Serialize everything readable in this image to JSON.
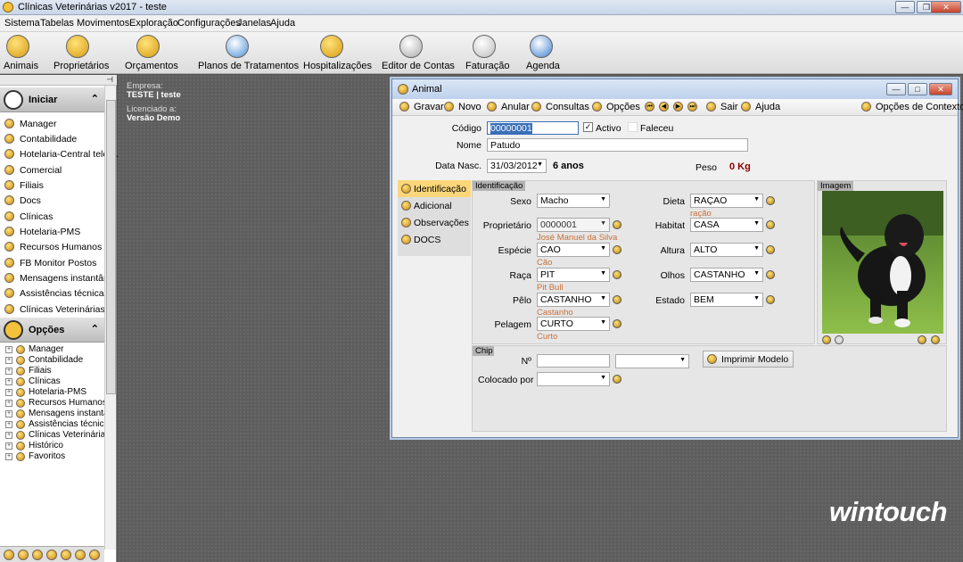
{
  "app": {
    "title": "Clínicas Veterinárias v2017 - teste"
  },
  "menu": [
    "Sistema",
    "Tabelas",
    "Movimentos",
    "Exploração",
    "Configurações",
    "Janelas",
    "Ajuda"
  ],
  "toolbar": [
    {
      "label": "Animais",
      "icon": "paw-icon"
    },
    {
      "label": "Proprietários",
      "icon": "hand-icon"
    },
    {
      "label": "Orçamentos",
      "icon": "calculator-icon"
    },
    {
      "label": "Planos de Tratamentos",
      "icon": "heart-plan-icon"
    },
    {
      "label": "Hospitalizações",
      "icon": "medical-cross-icon"
    },
    {
      "label": "Editor de Contas",
      "icon": "pen-edit-icon"
    },
    {
      "label": "Faturação",
      "icon": "coins-icon"
    },
    {
      "label": "Agenda",
      "icon": "agenda-check-icon"
    }
  ],
  "sidebar": {
    "pin": "⊣",
    "iniciar": {
      "title": "Iniciar",
      "items": [
        "Manager",
        "Contabilidade",
        "Hotelaria-Central telef...",
        "Comercial",
        "Filiais",
        "Docs",
        "Clínicas",
        "Hotelaria-PMS",
        "Recursos Humanos",
        "FB Monitor Postos",
        "Mensagens instantân...",
        "Assistências técnicas",
        "Clínicas Veterinárias"
      ]
    },
    "opcoes": {
      "title": "Opções",
      "items": [
        "Manager",
        "Contabilidade",
        "Filiais",
        "Clínicas",
        "Hotelaria-PMS",
        "Recursos Humanos",
        "Mensagens instantân",
        "Assistências técnicas",
        "Clínicas Veterinárias",
        "Histórico",
        "Favoritos"
      ]
    }
  },
  "company": {
    "empresa_label": "Empresa:",
    "empresa": "TESTE | teste",
    "lic_label": "Licenciado a:",
    "lic": "Versão Demo"
  },
  "brand": "wintouch",
  "animal_window": {
    "title": "Animal",
    "toolbar": {
      "gravar": "Gravar",
      "novo": "Novo",
      "anular": "Anular",
      "consultas": "Consultas",
      "opcoes": "Opções",
      "sair": "Sair",
      "ajuda": "Ajuda",
      "contexto": "Opções de Contexto"
    },
    "codigo_label": "Código",
    "codigo": "00000001",
    "activo": "Activo",
    "faleceu": "Faleceu",
    "nome_label": "Nome",
    "nome": "Patudo",
    "nasc_label": "Data Nasc.",
    "nasc": "31/03/2012",
    "idade": "6 anos",
    "peso_label": "Peso",
    "peso": "0 Kg",
    "tabs": [
      "Identificação",
      "Adicional",
      "Observações",
      "DOCS"
    ],
    "ident_title": "Identificação",
    "sexo_label": "Sexo",
    "sexo": "Macho",
    "prop_label": "Proprietário",
    "prop": "0000001",
    "prop_hint": "José Manuel da Silva",
    "especie_label": "Espécie",
    "especie": "CAO",
    "especie_hint": "Cão",
    "raca_label": "Raça",
    "raca": "PIT",
    "raca_hint": "Pit Bull",
    "pelo_label": "Pêlo",
    "pelo": "CASTANHO",
    "pelo_hint": "Castanho",
    "pelagem_label": "Pelagem",
    "pelagem": "CURTO",
    "pelagem_hint": "Curto",
    "dieta_label": "Dieta",
    "dieta": "RAÇAO",
    "dieta_hint": "ração",
    "habitat_label": "Habitat",
    "habitat": "CASA",
    "altura_label": "Altura",
    "altura": "ALTO",
    "olhos_label": "Olhos",
    "olhos": "CASTANHO",
    "estado_label": "Estado",
    "estado": "BEM",
    "imagem_title": "Imagem",
    "chip_title": "Chip",
    "n_label": "Nº",
    "colocado_label": "Colocado por",
    "imprimir": "Imprimir Modelo"
  }
}
